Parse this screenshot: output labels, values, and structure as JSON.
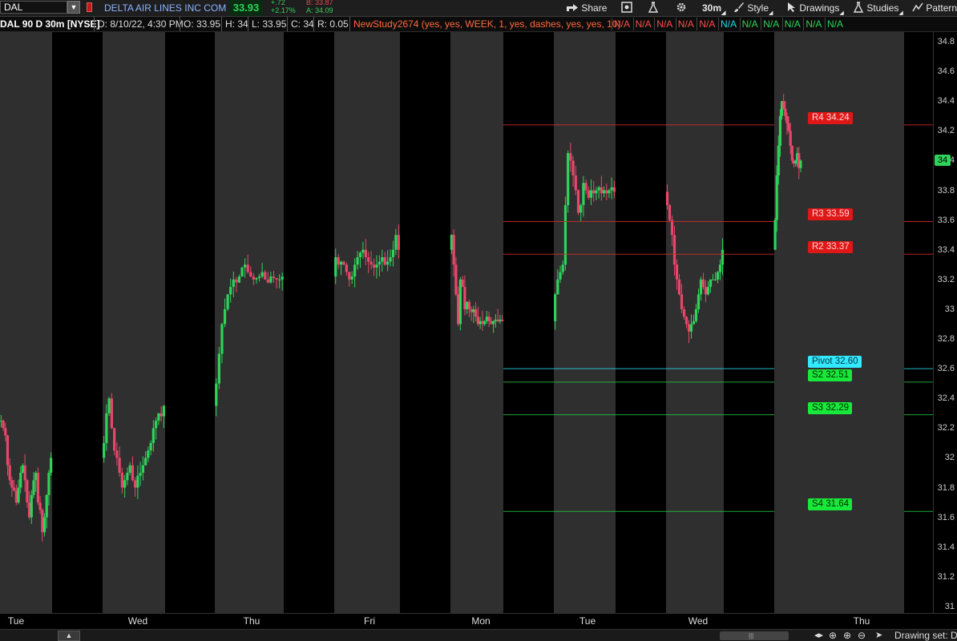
{
  "toolbar": {
    "symbol": "DAL",
    "company": "DELTA AIR LINES INC COM",
    "last": "33.93",
    "change": "+.72",
    "change_pct": "+2.17%",
    "bid": "B: 33.87",
    "ask": "A: 34.09",
    "share": "Share",
    "timeframe": "30m",
    "style": "Style",
    "drawings": "Drawings",
    "studies": "Studies",
    "patterns": "Pattern"
  },
  "info": {
    "title": "DAL 90 D 30m [NYSE]",
    "date": "D: 8/10/22, 4:30 PM",
    "open": "O: 33.95",
    "high": "H: 34",
    "low": "L: 33.95",
    "close": "C: 34",
    "range": "R: 0.05",
    "study": "NewStudy2674 (yes, yes, WEEK, 1, yes, dashes, yes, yes, 10)",
    "na_red": [
      "N/A",
      "N/A",
      "N/A",
      "N/A",
      "N/A"
    ],
    "na_cyan": [
      "N/A"
    ],
    "na_green": [
      "N/A",
      "N/A",
      "N/A",
      "N/A",
      "N/A"
    ]
  },
  "colors": {
    "up": "#2fd35a",
    "down": "#e8476b",
    "resistance": "#d92b2b",
    "support": "#22c43f",
    "pivot": "#27d9e8",
    "band_light": "#2f2f2f",
    "band_dark": "#000000"
  },
  "chart_data": {
    "type": "candlestick",
    "y_ticks": [
      "34.8",
      "34.6",
      "34.4",
      "34.2",
      "34",
      "33.8",
      "33.6",
      "33.4",
      "33.2",
      "33",
      "32.8",
      "32.6",
      "32.4",
      "32.2",
      "32",
      "31.8",
      "31.6",
      "31.4",
      "31.2",
      "31"
    ],
    "ylim": [
      30.9,
      34.85
    ],
    "x_labels": [
      "Tue",
      "Wed",
      "Thu",
      "Fri",
      "Mon",
      "Tue",
      "Wed",
      "Thu"
    ],
    "current_price": "34",
    "levels": [
      {
        "name": "R4",
        "value": 34.24,
        "label": "R4 34.24",
        "kind": "resistance"
      },
      {
        "name": "R3",
        "value": 33.59,
        "label": "R3 33.59",
        "kind": "resistance"
      },
      {
        "name": "R2",
        "value": 33.37,
        "label": "R2 33.37",
        "kind": "resistance"
      },
      {
        "name": "Pivot",
        "value": 32.6,
        "label": "Pivot 32.60",
        "kind": "pivot"
      },
      {
        "name": "S2",
        "value": 32.51,
        "label": "S2 32.51",
        "kind": "support"
      },
      {
        "name": "S3",
        "value": 32.29,
        "label": "S3 32.29",
        "kind": "support"
      },
      {
        "name": "S4",
        "value": 31.64,
        "label": "S4 31.64",
        "kind": "support"
      }
    ],
    "series": [
      {
        "name": "DAL",
        "days": [
          {
            "day": "Tue",
            "closes": [
              32.25,
              32.2,
              32.15,
              31.95,
              31.85,
              31.8,
              31.78,
              31.7,
              31.8,
              31.9,
              31.95,
              31.85,
              31.7,
              31.6,
              31.75,
              31.85,
              31.9,
              31.7,
              31.65,
              31.5,
              31.6,
              31.75,
              31.9,
              32.0
            ]
          },
          {
            "day": "Wed",
            "closes": [
              32.1,
              32.3,
              32.4,
              32.2,
              32.05,
              32.0,
              31.9,
              31.8,
              31.85,
              31.9,
              31.95,
              31.85,
              31.8,
              31.88,
              31.9,
              31.95,
              32.0,
              32.05,
              32.1,
              32.2,
              32.25,
              32.3,
              32.28,
              32.35
            ]
          },
          {
            "day": "Thu",
            "closes": [
              32.5,
              32.7,
              32.9,
              33.0,
              33.1,
              33.15,
              33.2,
              33.18,
              33.22,
              33.28,
              33.3,
              33.25,
              33.22,
              33.2,
              33.21,
              33.22,
              33.25,
              33.2,
              33.18,
              33.22,
              33.21,
              33.2,
              33.2,
              33.22
            ]
          },
          {
            "day": "Fri",
            "closes": [
              33.35,
              33.3,
              33.32,
              33.3,
              33.25,
              33.2,
              33.22,
              33.3,
              33.35,
              33.38,
              33.4,
              33.35,
              33.32,
              33.3,
              33.28,
              33.3,
              33.32,
              33.35,
              33.3,
              33.32,
              33.35,
              33.4,
              33.5,
              33.4
            ]
          },
          {
            "day": "Mon",
            "closes": [
              33.5,
              33.3,
              33.1,
              32.9,
              33.2,
              33.15,
              33.0,
              33.05,
              33.0,
              32.98,
              33.0,
              32.95,
              32.9,
              32.92,
              32.9,
              32.92,
              32.95,
              32.92,
              32.9,
              32.92,
              32.93,
              32.92,
              32.93,
              32.92
            ]
          },
          {
            "day": "Tue",
            "closes": [
              33.1,
              33.2,
              33.25,
              33.3,
              33.7,
              34.05,
              34.0,
              33.9,
              33.8,
              33.65,
              33.7,
              33.85,
              33.8,
              33.75,
              33.8,
              33.78,
              33.8,
              33.82,
              33.78,
              33.8,
              33.78,
              33.8,
              33.82,
              33.79
            ]
          },
          {
            "day": "Wed",
            "closes": [
              33.7,
              33.6,
              33.5,
              33.3,
              33.2,
              33.1,
              33.0,
              32.95,
              32.9,
              32.85,
              32.9,
              32.92,
              33.0,
              33.1,
              33.2,
              33.15,
              33.1,
              33.15,
              33.2,
              33.2,
              33.2,
              33.25,
              33.3,
              33.4
            ]
          },
          {
            "day": "Thu",
            "closes": [
              33.6,
              33.9,
              34.1,
              34.3,
              34.4,
              34.35,
              34.3,
              34.25,
              34.2,
              34.1,
              34.0,
              33.98,
              34.0,
              34.05,
              33.95,
              34.0
            ]
          }
        ]
      }
    ]
  }
}
